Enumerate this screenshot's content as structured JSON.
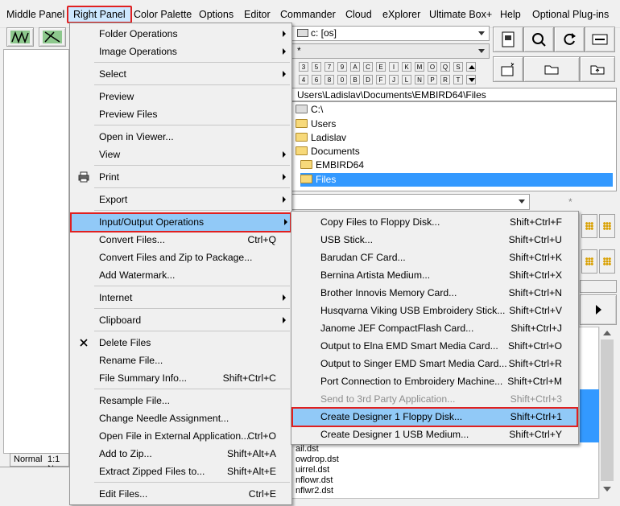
{
  "menubar": {
    "items": [
      "Middle Panel",
      "Right Panel",
      "Color Palette",
      "Options",
      "Editor",
      "Commander",
      "Cloud",
      "eXplorer",
      "Ultimate Box+",
      "Help",
      "Optional Plug-ins"
    ]
  },
  "right_panel": {
    "drive_select": "c: [os]",
    "filter_select": "*",
    "keys_row1": [
      "3",
      "5",
      "7",
      "9",
      "A",
      "C",
      "E",
      "I",
      "K",
      "M",
      "O",
      "Q",
      "S"
    ],
    "keys_row2": [
      "4",
      "6",
      "8",
      "0",
      "B",
      "D",
      "F",
      "J",
      "L",
      "N",
      "P",
      "R",
      "T"
    ],
    "path": "Users\\Ladislav\\Documents\\EMBIRD64\\Files",
    "tree": [
      "C:\\",
      "Users",
      "Ladislav",
      "Documents",
      "EMBIRD64",
      "Files"
    ],
    "search_star": "*",
    "files": [
      "ail.dst",
      "owdrop.dst",
      "uirrel.dst",
      "nflowr.dst",
      "nflwr2.dst"
    ]
  },
  "left_panel": {
    "tabs": [
      "Normal",
      "1:1 N"
    ]
  },
  "main_menu": {
    "items": [
      {
        "label": "Folder Operations",
        "submenu": true
      },
      {
        "label": "Image Operations",
        "submenu": true
      },
      {
        "label": "Select",
        "submenu": true
      },
      {
        "label": "Preview"
      },
      {
        "label": "Preview Files"
      },
      {
        "label": "Open in Viewer..."
      },
      {
        "label": "View",
        "submenu": true
      },
      {
        "label": "Print",
        "submenu": true,
        "icon": "printer-icon"
      },
      {
        "label": "Export",
        "submenu": true
      },
      {
        "label": "Input/Output Operations",
        "submenu": true,
        "highlighted": true
      },
      {
        "label": "Convert Files...",
        "shortcut": "Ctrl+Q"
      },
      {
        "label": "Convert Files and Zip to Package..."
      },
      {
        "label": "Add Watermark..."
      },
      {
        "label": "Internet",
        "submenu": true
      },
      {
        "label": "Clipboard",
        "submenu": true
      },
      {
        "label": "Delete Files",
        "icon": "delete-x-icon"
      },
      {
        "label": "Rename File..."
      },
      {
        "label": "File Summary Info...",
        "shortcut": "Shift+Ctrl+C"
      },
      {
        "label": "Resample File..."
      },
      {
        "label": "Change Needle Assignment..."
      },
      {
        "label": "Open File in External Application...",
        "shortcut": "Ctrl+O"
      },
      {
        "label": "Add to Zip...",
        "shortcut": "Shift+Alt+A"
      },
      {
        "label": "Extract Zipped Files to...",
        "shortcut": "Shift+Alt+E"
      },
      {
        "label": "Edit Files...",
        "shortcut": "Ctrl+E"
      }
    ]
  },
  "io_submenu": {
    "items": [
      {
        "label": "Copy Files to Floppy Disk...",
        "shortcut": "Shift+Ctrl+F"
      },
      {
        "label": "USB Stick...",
        "shortcut": "Shift+Ctrl+U"
      },
      {
        "label": "Barudan CF Card...",
        "shortcut": "Shift+Ctrl+K"
      },
      {
        "label": "Bernina Artista Medium...",
        "shortcut": "Shift+Ctrl+X"
      },
      {
        "label": "Brother Innovis Memory Card...",
        "shortcut": "Shift+Ctrl+N"
      },
      {
        "label": "Husqvarna Viking USB Embroidery Stick...",
        "shortcut": "Shift+Ctrl+V"
      },
      {
        "label": "Janome JEF CompactFlash Card...",
        "shortcut": "Shift+Ctrl+J"
      },
      {
        "label": "Output to Elna EMD Smart Media Card...",
        "shortcut": "Shift+Ctrl+O"
      },
      {
        "label": "Output to Singer EMD Smart Media Card...",
        "shortcut": "Shift+Ctrl+R"
      },
      {
        "label": "Port Connection to Embroidery Machine...",
        "shortcut": "Shift+Ctrl+M"
      },
      {
        "label": "Send to 3rd Party Application...",
        "shortcut": "Shift+Ctrl+3",
        "disabled": true
      },
      {
        "label": "Create Designer 1 Floppy Disk...",
        "shortcut": "Shift+Ctrl+1",
        "highlighted": true
      },
      {
        "label": "Create Designer 1 USB Medium...",
        "shortcut": "Shift+Ctrl+Y"
      }
    ]
  }
}
